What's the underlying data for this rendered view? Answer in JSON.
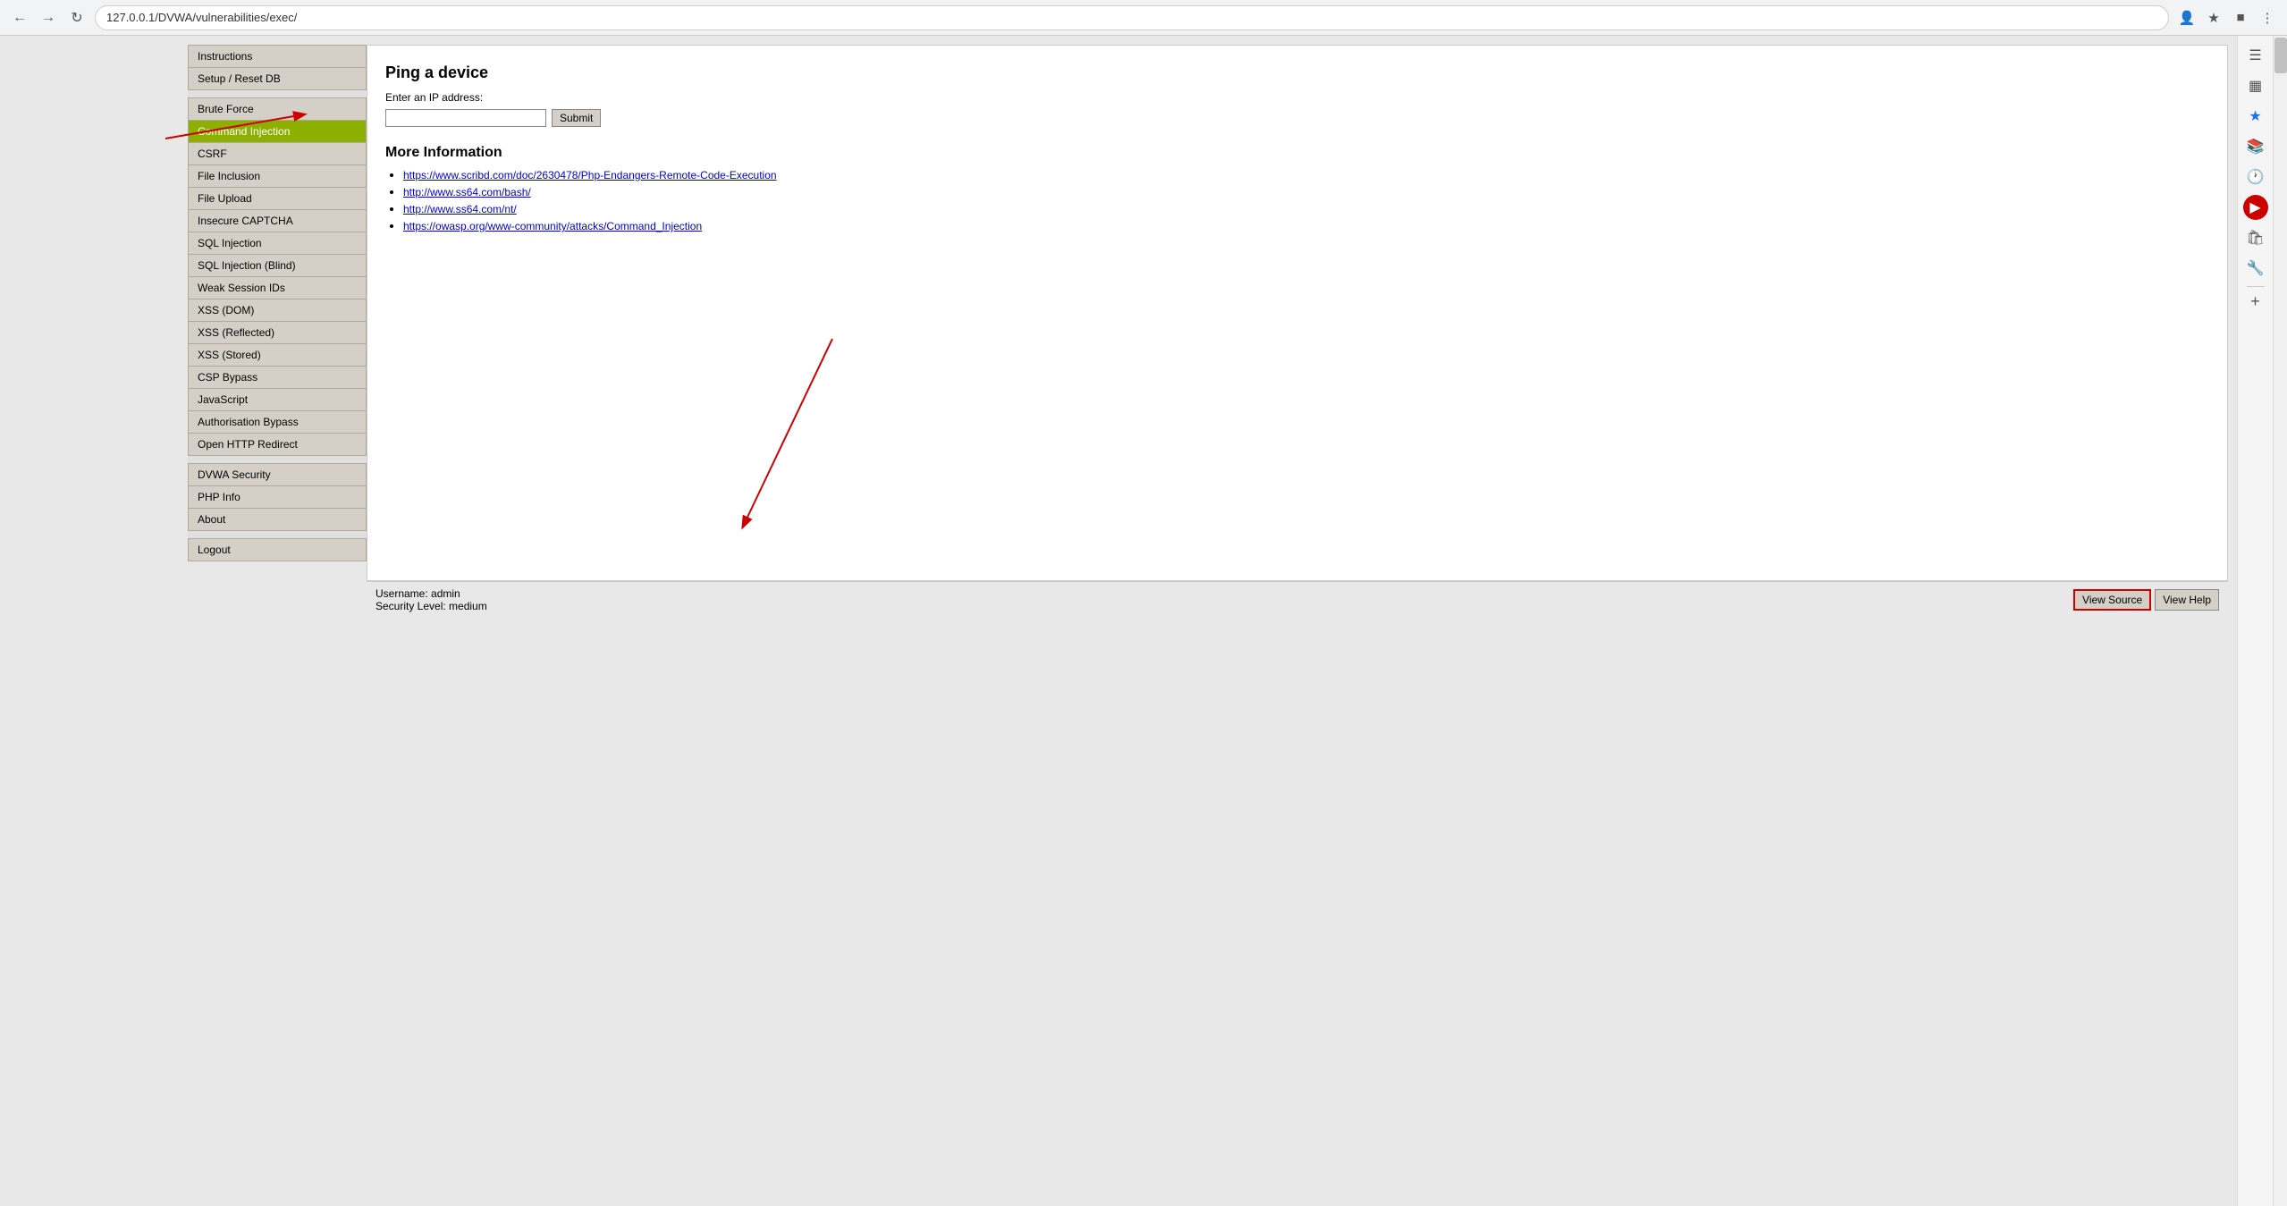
{
  "browser": {
    "url": "127.0.0.1/DVWA/vulnerabilities/exec/",
    "back_label": "←",
    "forward_label": "→",
    "reload_label": "↺"
  },
  "nav": {
    "group1": [
      {
        "label": "Instructions",
        "active": false
      },
      {
        "label": "Setup / Reset DB",
        "active": false
      }
    ],
    "group2": [
      {
        "label": "Brute Force",
        "active": false
      },
      {
        "label": "Command Injection",
        "active": true
      },
      {
        "label": "CSRF",
        "active": false
      },
      {
        "label": "File Inclusion",
        "active": false
      },
      {
        "label": "File Upload",
        "active": false
      },
      {
        "label": "Insecure CAPTCHA",
        "active": false
      },
      {
        "label": "SQL Injection",
        "active": false
      },
      {
        "label": "SQL Injection (Blind)",
        "active": false
      },
      {
        "label": "Weak Session IDs",
        "active": false
      },
      {
        "label": "XSS (DOM)",
        "active": false
      },
      {
        "label": "XSS (Reflected)",
        "active": false
      },
      {
        "label": "XSS (Stored)",
        "active": false
      },
      {
        "label": "CSP Bypass",
        "active": false
      },
      {
        "label": "JavaScript",
        "active": false
      },
      {
        "label": "Authorisation Bypass",
        "active": false
      },
      {
        "label": "Open HTTP Redirect",
        "active": false
      }
    ],
    "group3": [
      {
        "label": "DVWA Security",
        "active": false
      },
      {
        "label": "PHP Info",
        "active": false
      },
      {
        "label": "About",
        "active": false
      }
    ],
    "group4": [
      {
        "label": "Logout",
        "active": false
      }
    ]
  },
  "content": {
    "ping_title": "Ping a device",
    "ping_label": "Enter an IP address:",
    "ping_input_value": "",
    "submit_label": "Submit",
    "more_info_title": "More Information",
    "links": [
      {
        "url": "https://www.scribd.com/doc/2630478/Php-Endangers-Remote-Code-Execution",
        "text": "https://www.scribd.com/doc/2630478/Php-Endangers-Remote-Code-Execution"
      },
      {
        "url": "http://www.ss64.com/bash/",
        "text": "http://www.ss64.com/bash/"
      },
      {
        "url": "http://www.ss64.com/nt/",
        "text": "http://www.ss64.com/nt/"
      },
      {
        "url": "https://owasp.org/www-community/attacks/Command_Injection",
        "text": "https://owasp.org/www-community/attacks/Command_Injection"
      }
    ]
  },
  "footer": {
    "username_label": "Username:",
    "username": "admin",
    "security_label": "Security Level:",
    "security": "medium",
    "view_source_label": "View Source",
    "view_help_label": "View Help"
  },
  "annotations": {
    "command_injection_arrow": "points to Command Injection menu item",
    "view_source_arrow": "points to View Source button"
  }
}
